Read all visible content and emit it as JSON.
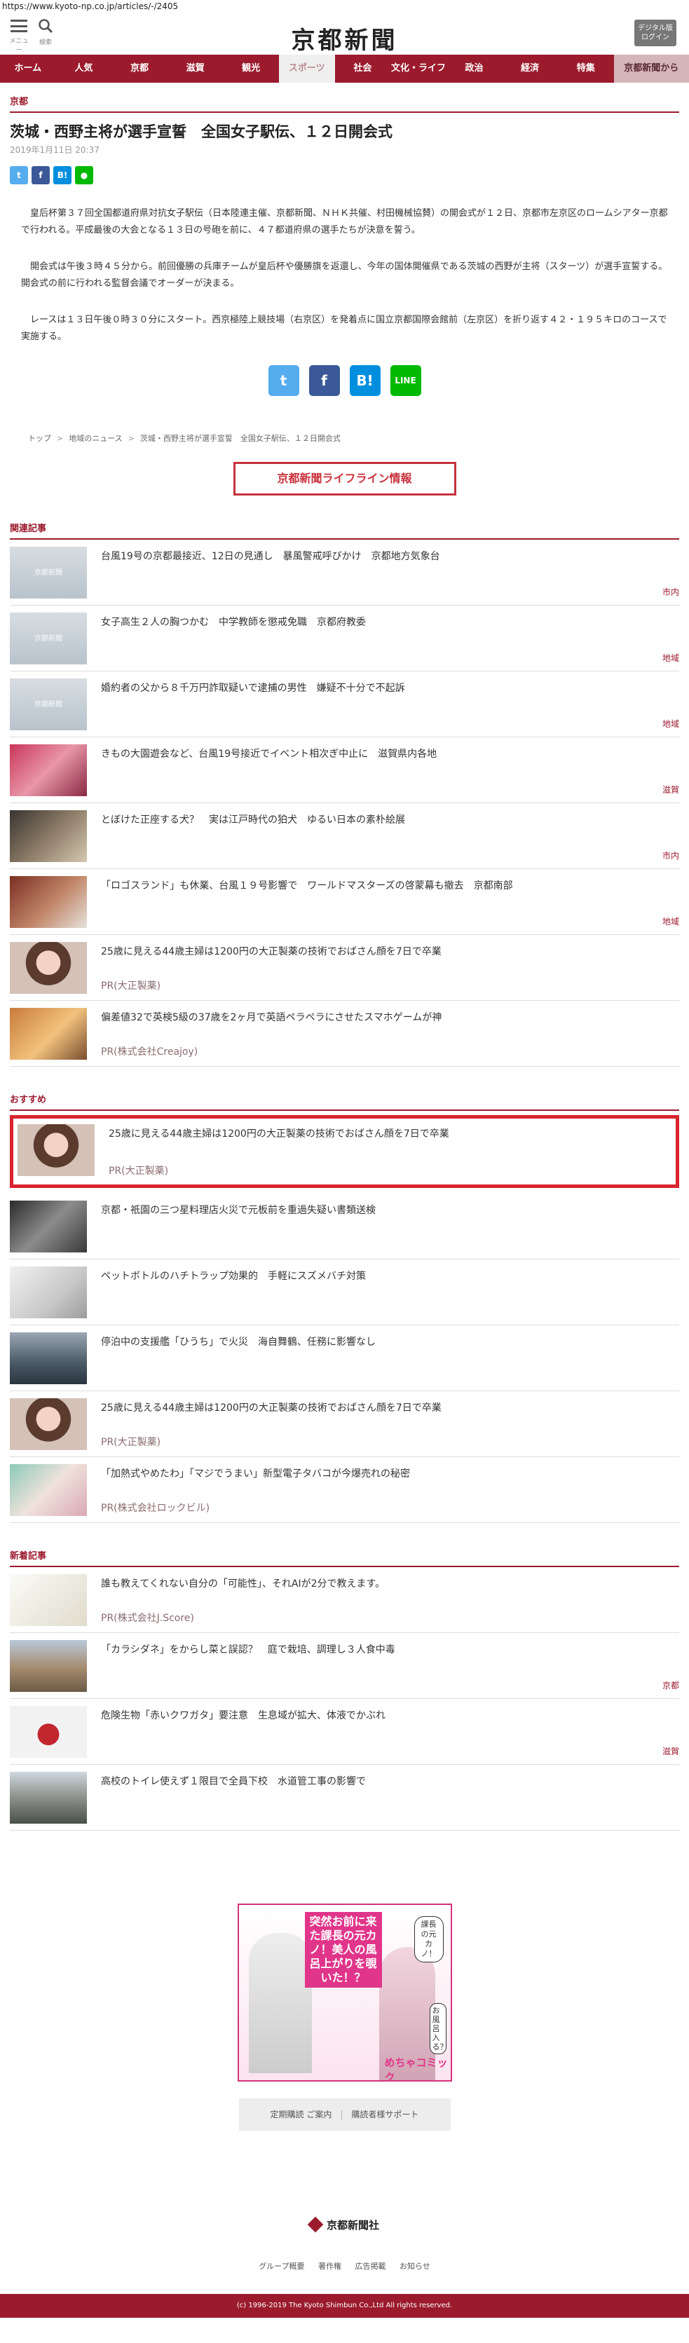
{
  "browser": {
    "url": "https://www.kyoto-np.co.jp/articles/-/2405"
  },
  "header": {
    "menu_label": "メニュー",
    "search_label": "検索",
    "logo_text": "京都新聞",
    "login_line1": "デジタル版",
    "login_line2": "ログイン"
  },
  "nav": {
    "items": [
      "ホーム",
      "人気",
      "京都",
      "滋賀",
      "観光",
      "スポーツ",
      "社会",
      "文化・ライフ",
      "政治",
      "経済",
      "特集",
      "京都新聞から"
    ],
    "active": "スポーツ"
  },
  "article": {
    "category": "京都",
    "title": "茨城・西野主将が選手宣誓　全国女子駅伝、１２日開会式",
    "date": "2019年1月11日 20:37",
    "paragraphs": [
      "皇后杯第３７回全国都道府県対抗女子駅伝（日本陸連主催、京都新聞、ＮＨＫ共催、村田機械協賛）の開会式が１２日、京都市左京区のロームシアター京都で行われる。平成最後の大会となる１３日の号砲を前に、４７都道府県の選手たちが決意を誓う。",
      "開会式は午後３時４５分から。前回優勝の兵庫チームが皇后杯や優勝旗を返還し、今年の国体開催県である茨城の西野が主将（スターツ）が選手宣誓する。開会式の前に行われる監督会議でオーダーが決まる。",
      "レースは１３日午後０時３０分にスタート。西京極陸上競技場（右京区）を発着点に国立京都国際会館前（左京区）を折り返す４２・１９５キロのコースで実施する。"
    ]
  },
  "share": {
    "twitter": "t",
    "facebook": "f",
    "hatena": "B!",
    "line": "LINE"
  },
  "breadcrumb": [
    "トップ",
    "地域のニュース",
    "茨城・西野主将が選手宣誓　全国女子駅伝、１２日開会式"
  ],
  "lifeline_button": "京都新聞ライフライン情報",
  "related": {
    "heading": "関連記事",
    "items": [
      {
        "title": "台風19号の京都最接近、12日の見通し　暴風警戒呼びかけ　京都地方気象台",
        "tag": "市内"
      },
      {
        "title": "女子高生２人の胸つかむ　中学教師を懲戒免職　京都府教委",
        "tag": "地域"
      },
      {
        "title": "婚約者の父から８千万円詐取疑いで逮捕の男性　嫌疑不十分で不起訴",
        "tag": "地域"
      },
      {
        "title": "きもの大園遊会など、台風19号接近でイベント相次ぎ中止に　滋賀県内各地",
        "tag": "滋賀"
      },
      {
        "title": "とぼけた正座する犬？　実は江戸時代の狛犬　ゆるい日本の素朴絵展",
        "tag": "市内"
      },
      {
        "title": "「ロゴスランド」も休業、台風１９号影響で　ワールドマスターズの啓蒙幕も撤去　京都南部",
        "tag": "地域"
      },
      {
        "title": "25歳に見える44歳主婦は1200円の大正製薬の技術でおばさん顔を7日で卒業",
        "pr": "PR(大正製薬)"
      },
      {
        "title": "偏差値32で英検5級の37歳を2ヶ月で英語ペラペラにさせたスマホゲームが神",
        "pr": "PR(株式会社Creajoy)"
      }
    ]
  },
  "recommended": {
    "heading": "おすすめ",
    "items": [
      {
        "title": "25歳に見える44歳主婦は1200円の大正製薬の技術でおばさん顔を7日で卒業",
        "pr": "PR(大正製薬)"
      },
      {
        "title": "京都・祇園の三つ星料理店火災で元板前を重過失疑い書類送検"
      },
      {
        "title": "ペットボトルのハチトラップ効果的　手軽にスズメバチ対策"
      },
      {
        "title": "停泊中の支援艦「ひうち」で火災　海自舞鶴、任務に影響なし"
      },
      {
        "title": "25歳に見える44歳主婦は1200円の大正製薬の技術でおばさん顔を7日で卒業",
        "pr": "PR(大正製薬)"
      },
      {
        "title": "「加熱式やめたわ」「マジでうまい」新型電子タバコが今爆売れの秘密",
        "pr": "PR(株式会社ロックビル)"
      }
    ]
  },
  "latest": {
    "heading": "新着記事",
    "items": [
      {
        "title": "誰も教えてくれない自分の「可能性」、それAIが2分で教えます。",
        "pr": "PR(株式会社J.Score)"
      },
      {
        "title": "「カラシダネ」をからし菜と誤認？　庭で栽培、調理し３人食中毒",
        "tag": "京都"
      },
      {
        "title": "危険生物「赤いクワガタ」要注意　生息域が拡大、体液でかぶれ",
        "tag": "滋賀"
      },
      {
        "title": "高校のトイレ使えず１限目で全員下校　水道管工事の影響で"
      }
    ]
  },
  "ad": {
    "headline": "突然お前に来た課長の元カノ！美人の風呂上がりを覗いた！？",
    "bubble1": "課長の元カノ！",
    "bubble2": "お風呂入る？",
    "brand": "めちゃコミック"
  },
  "subscription": {
    "link1": "定期購読 ご案内",
    "link2": "購読者様サポート"
  },
  "footer": {
    "logo": "京都新聞社",
    "links": [
      "グループ概要",
      "著作権",
      "広告掲載",
      "お知らせ"
    ],
    "copyright": "(c) 1996-2019 The Kyoto Shimbun Co.,Ltd All rights reserved."
  }
}
